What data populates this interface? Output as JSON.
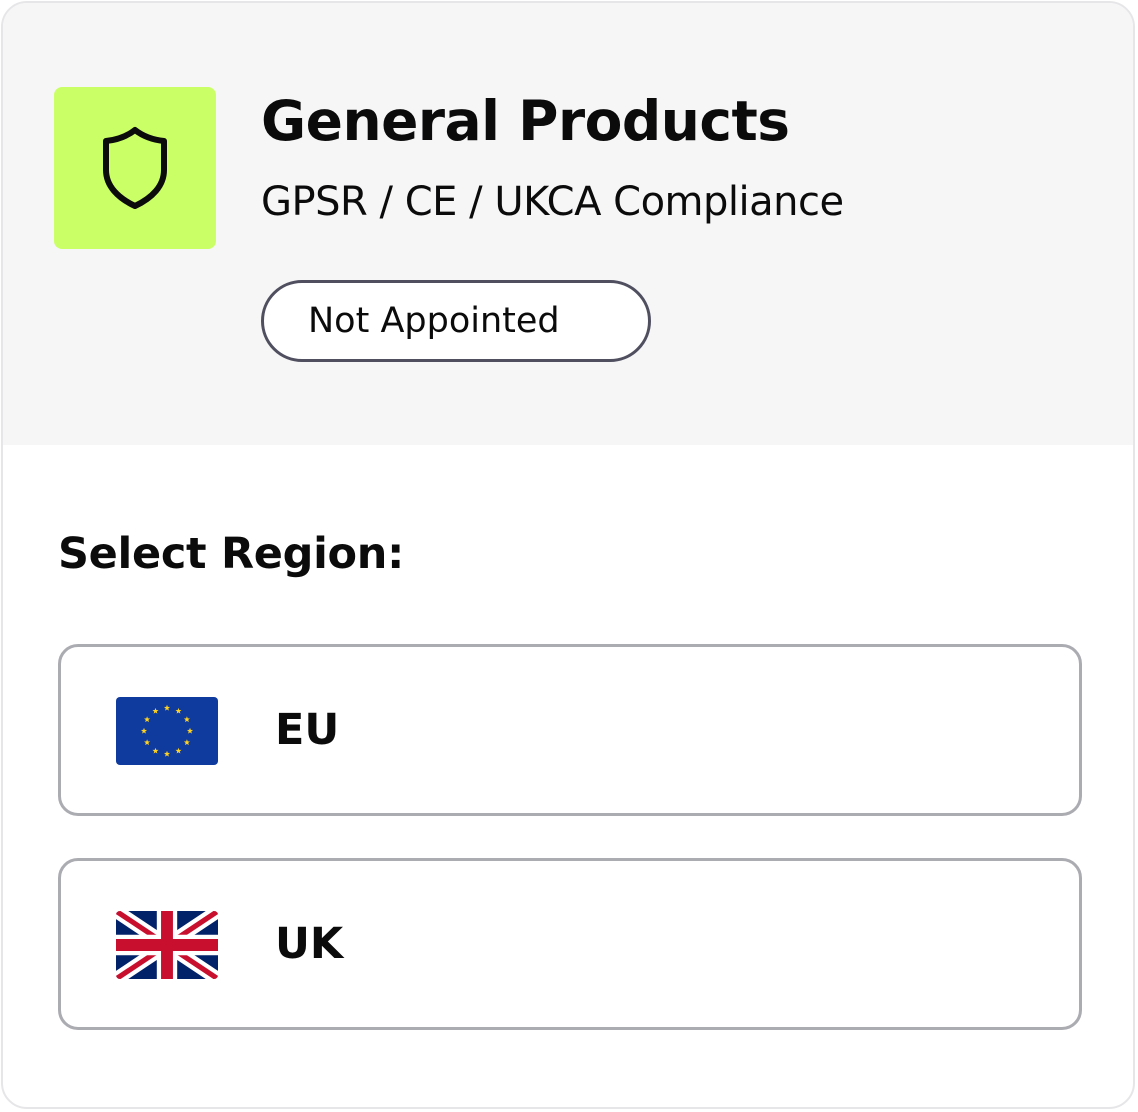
{
  "product": {
    "icon": "shield-icon",
    "accent_color": "#cbff66",
    "title": "General Products",
    "subtitle": "GPSR / CE / UKCA Compliance",
    "status": "Not Appointed"
  },
  "region_section": {
    "label": "Select Region:",
    "options": [
      {
        "label": "EU",
        "icon": "eu-flag-icon"
      },
      {
        "label": "UK",
        "icon": "uk-flag-icon"
      }
    ]
  }
}
